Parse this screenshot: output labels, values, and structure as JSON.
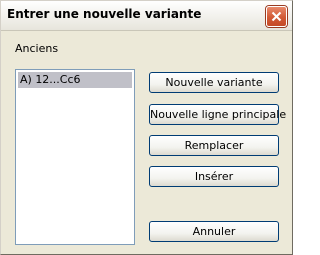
{
  "window": {
    "title": "Entrer une nouvelle variante"
  },
  "group": {
    "label": "Anciens"
  },
  "list": {
    "items": [
      {
        "label": "A) 12...Cc6",
        "selected": true
      }
    ]
  },
  "buttons": {
    "new_variant": "Nouvelle variante",
    "new_main_line": "Nouvelle ligne principale",
    "replace": "Remplacer",
    "insert": "Insérer",
    "cancel": "Annuler"
  },
  "colors": {
    "dialog_background": "#ece9d8",
    "close_button": "#d25a36",
    "selection": "#c0c0c8",
    "button_border": "#003c74"
  },
  "icons": {
    "close": "close-icon"
  }
}
